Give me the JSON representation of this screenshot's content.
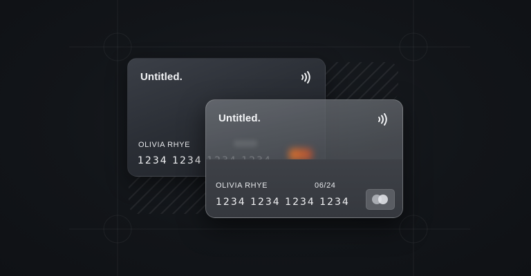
{
  "back_card": {
    "brand": "Untitled.",
    "cardholder": "OLIVIA RHYE",
    "number": "1234 1234 1234 1234"
  },
  "front_card": {
    "brand": "Untitled.",
    "cardholder": "OLIVIA RHYE",
    "expiry": "06/24",
    "number": "1234 1234 1234 1234"
  },
  "icons": {
    "contactless": "contactless-icon",
    "card_network": "mastercard-logo-icon"
  },
  "colors": {
    "background": "#111418",
    "card_back": "#2b2f36",
    "card_front_glass": "#5a5e64",
    "text": "#f2f3f5"
  }
}
